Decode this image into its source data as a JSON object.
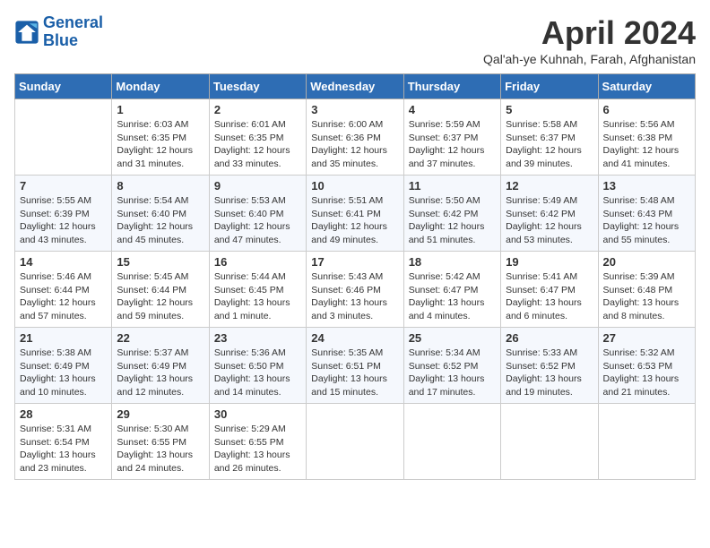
{
  "header": {
    "logo_line1": "General",
    "logo_line2": "Blue",
    "title": "April 2024",
    "subtitle": "Qal'ah-ye Kuhnah, Farah, Afghanistan"
  },
  "days_of_week": [
    "Sunday",
    "Monday",
    "Tuesday",
    "Wednesday",
    "Thursday",
    "Friday",
    "Saturday"
  ],
  "weeks": [
    [
      {
        "day": "",
        "info": ""
      },
      {
        "day": "1",
        "info": "Sunrise: 6:03 AM\nSunset: 6:35 PM\nDaylight: 12 hours\nand 31 minutes."
      },
      {
        "day": "2",
        "info": "Sunrise: 6:01 AM\nSunset: 6:35 PM\nDaylight: 12 hours\nand 33 minutes."
      },
      {
        "day": "3",
        "info": "Sunrise: 6:00 AM\nSunset: 6:36 PM\nDaylight: 12 hours\nand 35 minutes."
      },
      {
        "day": "4",
        "info": "Sunrise: 5:59 AM\nSunset: 6:37 PM\nDaylight: 12 hours\nand 37 minutes."
      },
      {
        "day": "5",
        "info": "Sunrise: 5:58 AM\nSunset: 6:37 PM\nDaylight: 12 hours\nand 39 minutes."
      },
      {
        "day": "6",
        "info": "Sunrise: 5:56 AM\nSunset: 6:38 PM\nDaylight: 12 hours\nand 41 minutes."
      }
    ],
    [
      {
        "day": "7",
        "info": "Sunrise: 5:55 AM\nSunset: 6:39 PM\nDaylight: 12 hours\nand 43 minutes."
      },
      {
        "day": "8",
        "info": "Sunrise: 5:54 AM\nSunset: 6:40 PM\nDaylight: 12 hours\nand 45 minutes."
      },
      {
        "day": "9",
        "info": "Sunrise: 5:53 AM\nSunset: 6:40 PM\nDaylight: 12 hours\nand 47 minutes."
      },
      {
        "day": "10",
        "info": "Sunrise: 5:51 AM\nSunset: 6:41 PM\nDaylight: 12 hours\nand 49 minutes."
      },
      {
        "day": "11",
        "info": "Sunrise: 5:50 AM\nSunset: 6:42 PM\nDaylight: 12 hours\nand 51 minutes."
      },
      {
        "day": "12",
        "info": "Sunrise: 5:49 AM\nSunset: 6:42 PM\nDaylight: 12 hours\nand 53 minutes."
      },
      {
        "day": "13",
        "info": "Sunrise: 5:48 AM\nSunset: 6:43 PM\nDaylight: 12 hours\nand 55 minutes."
      }
    ],
    [
      {
        "day": "14",
        "info": "Sunrise: 5:46 AM\nSunset: 6:44 PM\nDaylight: 12 hours\nand 57 minutes."
      },
      {
        "day": "15",
        "info": "Sunrise: 5:45 AM\nSunset: 6:44 PM\nDaylight: 12 hours\nand 59 minutes."
      },
      {
        "day": "16",
        "info": "Sunrise: 5:44 AM\nSunset: 6:45 PM\nDaylight: 13 hours\nand 1 minute."
      },
      {
        "day": "17",
        "info": "Sunrise: 5:43 AM\nSunset: 6:46 PM\nDaylight: 13 hours\nand 3 minutes."
      },
      {
        "day": "18",
        "info": "Sunrise: 5:42 AM\nSunset: 6:47 PM\nDaylight: 13 hours\nand 4 minutes."
      },
      {
        "day": "19",
        "info": "Sunrise: 5:41 AM\nSunset: 6:47 PM\nDaylight: 13 hours\nand 6 minutes."
      },
      {
        "day": "20",
        "info": "Sunrise: 5:39 AM\nSunset: 6:48 PM\nDaylight: 13 hours\nand 8 minutes."
      }
    ],
    [
      {
        "day": "21",
        "info": "Sunrise: 5:38 AM\nSunset: 6:49 PM\nDaylight: 13 hours\nand 10 minutes."
      },
      {
        "day": "22",
        "info": "Sunrise: 5:37 AM\nSunset: 6:49 PM\nDaylight: 13 hours\nand 12 minutes."
      },
      {
        "day": "23",
        "info": "Sunrise: 5:36 AM\nSunset: 6:50 PM\nDaylight: 13 hours\nand 14 minutes."
      },
      {
        "day": "24",
        "info": "Sunrise: 5:35 AM\nSunset: 6:51 PM\nDaylight: 13 hours\nand 15 minutes."
      },
      {
        "day": "25",
        "info": "Sunrise: 5:34 AM\nSunset: 6:52 PM\nDaylight: 13 hours\nand 17 minutes."
      },
      {
        "day": "26",
        "info": "Sunrise: 5:33 AM\nSunset: 6:52 PM\nDaylight: 13 hours\nand 19 minutes."
      },
      {
        "day": "27",
        "info": "Sunrise: 5:32 AM\nSunset: 6:53 PM\nDaylight: 13 hours\nand 21 minutes."
      }
    ],
    [
      {
        "day": "28",
        "info": "Sunrise: 5:31 AM\nSunset: 6:54 PM\nDaylight: 13 hours\nand 23 minutes."
      },
      {
        "day": "29",
        "info": "Sunrise: 5:30 AM\nSunset: 6:55 PM\nDaylight: 13 hours\nand 24 minutes."
      },
      {
        "day": "30",
        "info": "Sunrise: 5:29 AM\nSunset: 6:55 PM\nDaylight: 13 hours\nand 26 minutes."
      },
      {
        "day": "",
        "info": ""
      },
      {
        "day": "",
        "info": ""
      },
      {
        "day": "",
        "info": ""
      },
      {
        "day": "",
        "info": ""
      }
    ]
  ]
}
